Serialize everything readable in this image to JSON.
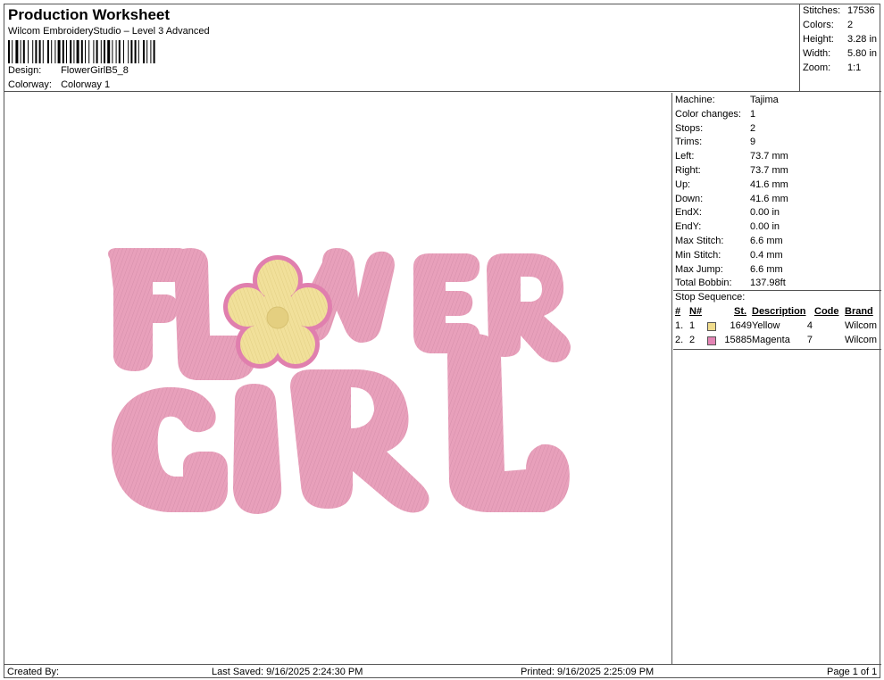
{
  "header": {
    "title": "Production Worksheet",
    "subtitle": "Wilcom EmbroideryStudio – Level 3 Advanced",
    "design_label": "Design:",
    "design_value": "FlowerGirlB5_8",
    "colorway_label": "Colorway:",
    "colorway_value": "Colorway 1"
  },
  "stats": {
    "stitches_label": "Stitches:",
    "stitches_value": "17536",
    "colors_label": "Colors:",
    "colors_value": "2",
    "height_label": "Height:",
    "height_value": "3.28 in",
    "width_label": "Width:",
    "width_value": "5.80 in",
    "zoom_label": "Zoom:",
    "zoom_value": "1:1"
  },
  "machine_info": [
    {
      "label": "Machine:",
      "value": "Tajima"
    },
    {
      "label": "Color changes:",
      "value": "1"
    },
    {
      "label": "Stops:",
      "value": "2"
    },
    {
      "label": "Trims:",
      "value": "9"
    },
    {
      "label": "Left:",
      "value": "73.7 mm"
    },
    {
      "label": "Right:",
      "value": "73.7 mm"
    },
    {
      "label": "Up:",
      "value": "41.6 mm"
    },
    {
      "label": "Down:",
      "value": "41.6 mm"
    },
    {
      "label": "EndX:",
      "value": "0.00 in"
    },
    {
      "label": "EndY:",
      "value": "0.00 in"
    },
    {
      "label": "Max Stitch:",
      "value": "6.6 mm"
    },
    {
      "label": "Min Stitch:",
      "value": "0.4 mm"
    },
    {
      "label": "Max Jump:",
      "value": "6.6 mm"
    },
    {
      "label": "Total Bobbin:",
      "value": "137.98ft"
    }
  ],
  "stop_sequence": {
    "title": "Stop Sequence:",
    "headers": {
      "num": "#",
      "n": "N#",
      "st": "St.",
      "desc": "Description",
      "code": "Code",
      "brand": "Brand"
    },
    "rows": [
      {
        "num": "1.",
        "n": "1",
        "color": "#f0dc8c",
        "st": "1649",
        "desc": "Yellow",
        "code": "4",
        "brand": "Wilcom"
      },
      {
        "num": "2.",
        "n": "2",
        "color": "#e384b4",
        "st": "15885",
        "desc": "Magenta",
        "code": "7",
        "brand": "Wilcom"
      }
    ]
  },
  "design": {
    "pink_color": "#e8a0bb",
    "pink_shadow": "#d98aa9",
    "yellow_color": "#f1e09a",
    "flower_outline": "#e07fae"
  },
  "footer": {
    "created_by": "Created By:",
    "last_saved": "Last Saved: 9/16/2025 2:24:30 PM",
    "printed": "Printed: 9/16/2025 2:25:09 PM",
    "page": "Page 1 of 1"
  }
}
